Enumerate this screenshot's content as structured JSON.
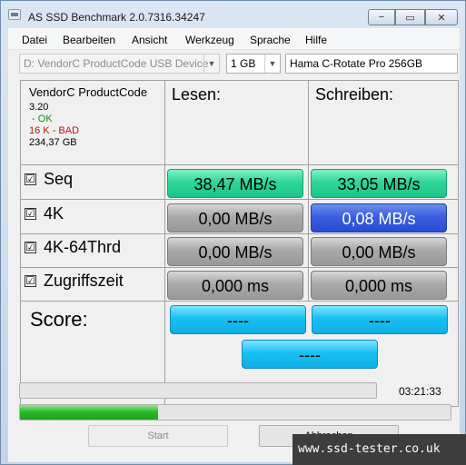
{
  "window": {
    "title": "AS SSD Benchmark 2.0.7316.34247",
    "controls": {
      "minimize": "−",
      "maximize": "▭",
      "close": "✕"
    }
  },
  "menu": [
    "Datei",
    "Bearbeiten",
    "Ansicht",
    "Werkzeug",
    "Sprache",
    "Hilfe"
  ],
  "toolbar": {
    "drive_select": "D: VendorC ProductCode USB Device",
    "size_select": "1 GB",
    "drive_label": "Hama C-Rotate Pro 256GB"
  },
  "drive_info": {
    "name": "VendorC ProductCode",
    "firmware": "3.20",
    "status": " - OK",
    "alignment": "16 K - BAD",
    "capacity": "234,37 GB"
  },
  "columns": {
    "read": "Lesen:",
    "write": "Schreiben:"
  },
  "rows": [
    {
      "label": "Seq",
      "checked": true,
      "read": "38,47 MB/s",
      "write": "33,05 MB/s"
    },
    {
      "label": "4K",
      "checked": true,
      "read": "0,00 MB/s",
      "write": "0,08 MB/s"
    },
    {
      "label": "4K-64Thrd",
      "checked": true,
      "read": "0,00 MB/s",
      "write": "0,00 MB/s"
    },
    {
      "label": "Zugriffszeit",
      "checked": true,
      "read": "0,000 ms",
      "write": "0,000 ms"
    }
  ],
  "checkmark": "☑",
  "score": {
    "label": "Score:",
    "read": "----",
    "write": "----",
    "total": "----"
  },
  "progress": {
    "top_fraction": 0.0,
    "bottom_fraction": 0.32,
    "elapsed": "03:21:33"
  },
  "buttons": {
    "start": "Start",
    "abort": "Abbrechen"
  },
  "watermark": "www.ssd-tester.co.uk",
  "colors": {
    "green": "#2fd699",
    "blue": "#3b5fe0",
    "gray": "#a9a9a9",
    "cyan": "#19bff2"
  }
}
